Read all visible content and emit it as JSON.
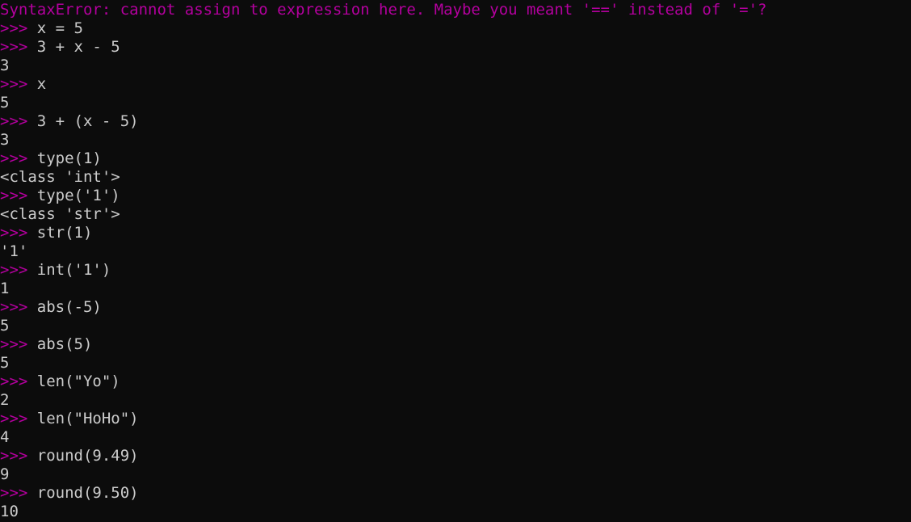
{
  "terminal": {
    "colors": {
      "background": "#0c0c0c",
      "foreground": "#cccccc",
      "prompt": "#b4009e",
      "error": "#b4009e"
    },
    "error": {
      "type": "SyntaxError",
      "message": ": cannot assign to expression here. Maybe you meant '==' instead of '='?"
    },
    "prompt": ">>> ",
    "entries": [
      {
        "input": "x = 5",
        "output": null
      },
      {
        "input": "3 + x - 5",
        "output": "3"
      },
      {
        "input": "x",
        "output": "5"
      },
      {
        "input": "3 + (x - 5)",
        "output": "3"
      },
      {
        "input": "type(1)",
        "output": "<class 'int'>"
      },
      {
        "input": "type('1')",
        "output": "<class 'str'>"
      },
      {
        "input": "str(1)",
        "output": "'1'"
      },
      {
        "input": "int('1')",
        "output": "1"
      },
      {
        "input": "abs(-5)",
        "output": "5"
      },
      {
        "input": "abs(5)",
        "output": "5"
      },
      {
        "input": "len(\"Yo\")",
        "output": "2"
      },
      {
        "input": "len(\"HoHo\")",
        "output": "4"
      },
      {
        "input": "round(9.49)",
        "output": "9"
      },
      {
        "input": "round(9.50)",
        "output": "10"
      }
    ]
  }
}
